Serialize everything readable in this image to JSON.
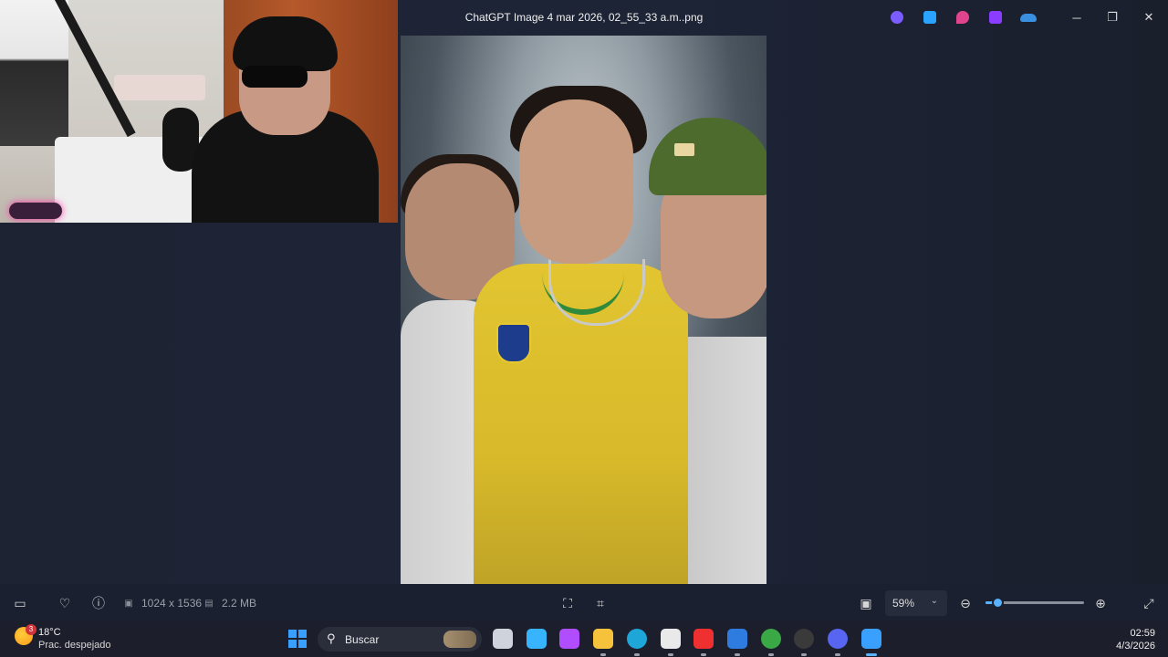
{
  "window": {
    "title": "ChatGPT Image 4 mar 2026, 02_55_33 a.m..png",
    "title_icons": [
      {
        "name": "copilot-icon",
        "color": "#7b5cff"
      },
      {
        "name": "photos-icon",
        "color": "#2aa3ff"
      },
      {
        "name": "designer-icon",
        "color": "#e0448c"
      },
      {
        "name": "clipchamp-icon",
        "color": "#8a3dff"
      },
      {
        "name": "onedrive-off-icon",
        "color": "#3b8fe0"
      }
    ],
    "controls": {
      "minimize": "─",
      "restore": "❐",
      "close": "✕"
    }
  },
  "toolbar": {
    "filmstrip_icon": "▭",
    "favorite_icon": "♡",
    "info_icon": "ⓘ",
    "dimensions": "1024 x 1536",
    "file_size": "2.2 MB",
    "zoom": {
      "value": "59%",
      "dropdown": "⌄",
      "level_fraction": 0.12
    },
    "zoom_out_icon": "⊖",
    "zoom_in_icon": "⊕",
    "fullscreen_icon": "⤢"
  },
  "taskbar": {
    "weather": {
      "temp": "18°C",
      "condition": "Prac. despejado",
      "badge": "3"
    },
    "search_placeholder": "Buscar",
    "apps": [
      {
        "name": "task-view-icon",
        "color": "#cfd3dc"
      },
      {
        "name": "copilot-icon",
        "color": "#38b4ff"
      },
      {
        "name": "copilot-app-icon",
        "color": "#b04dff"
      },
      {
        "name": "file-explorer-icon",
        "color": "#f6c23c"
      },
      {
        "name": "edge-icon",
        "color": "#1fa6d8"
      },
      {
        "name": "store-icon",
        "color": "#e9e9e9"
      },
      {
        "name": "anydesk-icon",
        "color": "#ef3030"
      },
      {
        "name": "outlook-icon",
        "color": "#2f7ce0"
      },
      {
        "name": "chrome-icon",
        "color": "#39a845"
      },
      {
        "name": "obs-icon",
        "color": "#3a3a3a"
      },
      {
        "name": "discord-icon",
        "color": "#5865f2"
      },
      {
        "name": "photos-active-icon",
        "color": "#3aa0ff"
      }
    ],
    "clock": {
      "time": "02:59",
      "date": "4/3/2026"
    }
  }
}
